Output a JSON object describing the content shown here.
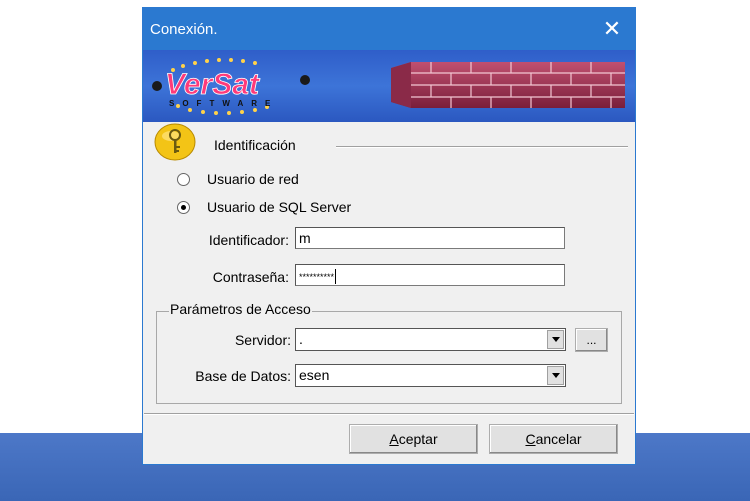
{
  "dialog": {
    "title": "Conexión.",
    "close_glyph": "✕"
  },
  "banner": {
    "logo_text": "VerSat",
    "logo_subtext": "SOFTWARE"
  },
  "identification": {
    "section_label": "Identificación",
    "icon": "key-icon",
    "radio_network": "Usuario de red",
    "radio_sql": "Usuario de SQL Server",
    "selected": "sql",
    "identifier_label": "Identificador:",
    "identifier_value": "m",
    "password_label": "Contraseña:",
    "password_value": "**********"
  },
  "access": {
    "group_label": "Parámetros de Acceso",
    "server_label": "Servidor:",
    "server_value": ".",
    "browse_label": "...",
    "database_label": "Base de Datos:",
    "database_value": "esen"
  },
  "buttons": {
    "accept_prefix": "A",
    "accept_rest": "ceptar",
    "cancel_prefix": "C",
    "cancel_rest": "ancelar"
  },
  "colors": {
    "titlebar": "#2b79d0",
    "taskbar": "#4472c4"
  }
}
